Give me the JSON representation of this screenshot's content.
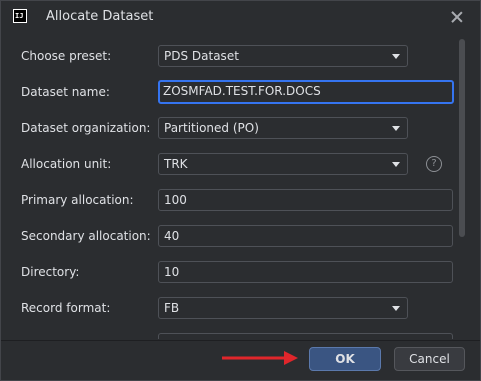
{
  "window": {
    "title": "Allocate Dataset",
    "app_icon_text": "IJ"
  },
  "form": {
    "choose_preset": {
      "label": "Choose preset:",
      "value": "PDS Dataset"
    },
    "dataset_name": {
      "label": "Dataset name:",
      "value": "ZOSMFAD.TEST.FOR.DOCS"
    },
    "dataset_organization": {
      "label": "Dataset organization:",
      "value": "Partitioned (PO)"
    },
    "allocation_unit": {
      "label": "Allocation unit:",
      "value": "TRK",
      "help": "?"
    },
    "primary_allocation": {
      "label": "Primary allocation:",
      "value": "100"
    },
    "secondary_allocation": {
      "label": "Secondary allocation:",
      "value": "40"
    },
    "directory": {
      "label": "Directory:",
      "value": "10"
    },
    "record_format": {
      "label": "Record format:",
      "value": "FB"
    }
  },
  "buttons": {
    "ok": "OK",
    "cancel": "Cancel"
  },
  "colors": {
    "background": "#2b2d30",
    "focus": "#3574f0",
    "primary_button": "#3a5582",
    "annotation_arrow": "#e0262b"
  }
}
